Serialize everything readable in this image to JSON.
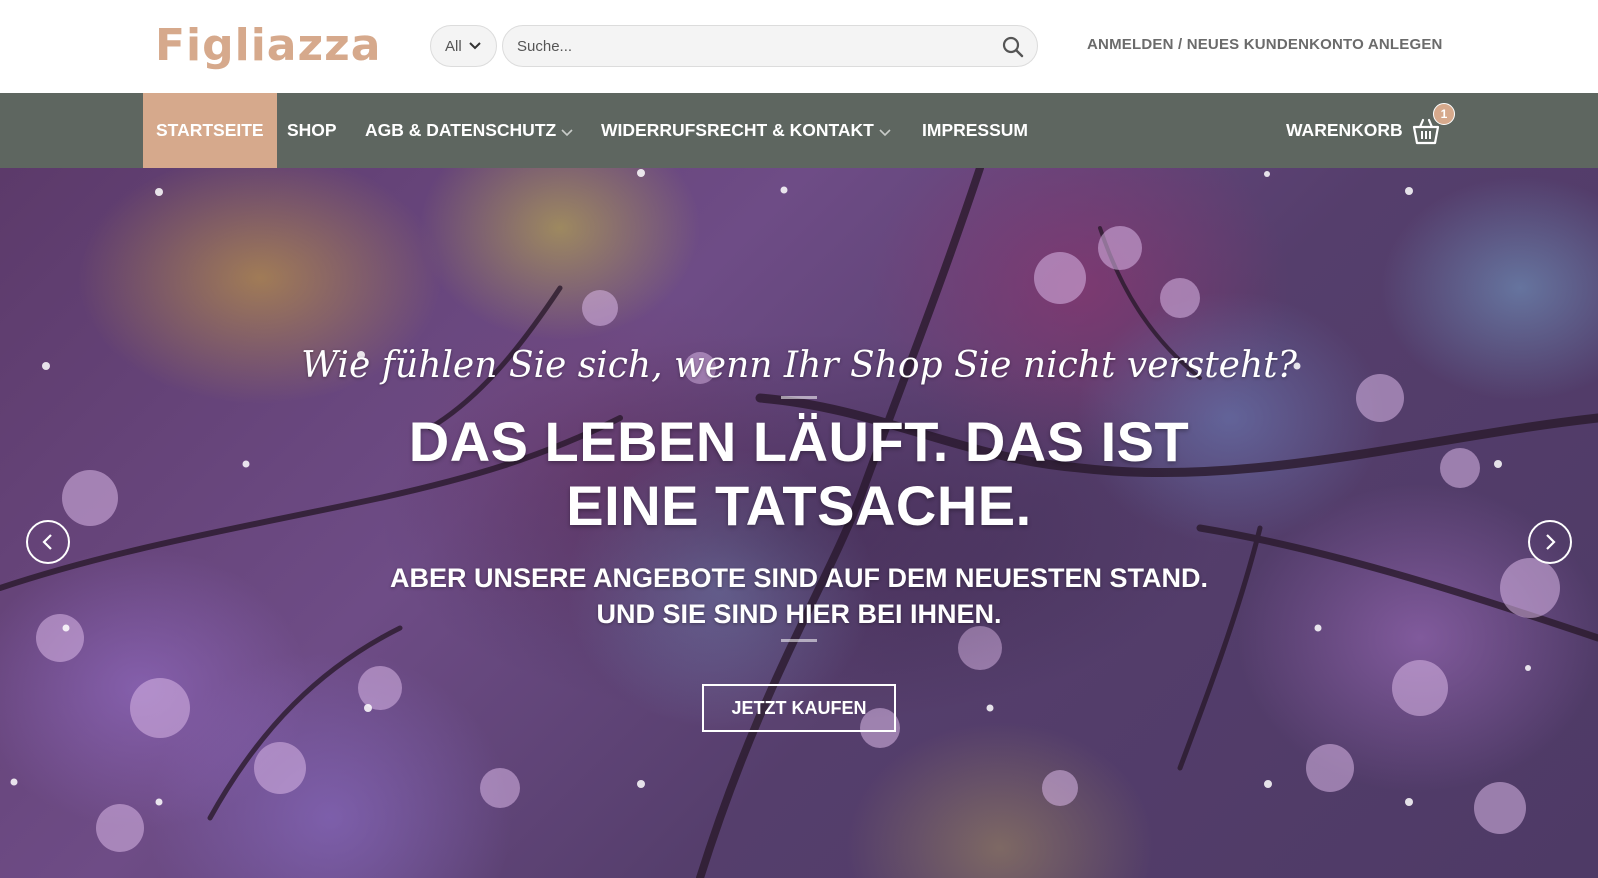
{
  "header": {
    "logo_text": "Figliazza",
    "category_select": "All",
    "search_placeholder": "Suche...",
    "account_link": "ANMELDEN / NEUES KUNDENKONTO ANLEGEN"
  },
  "nav": {
    "items": [
      {
        "label": "STARTSEITE",
        "active": true
      },
      {
        "label": "SHOP"
      },
      {
        "label": "AGB & DATENSCHUTZ",
        "dropdown": true
      },
      {
        "label": "WIDERRUFSRECHT & KONTAKT",
        "dropdown": true
      },
      {
        "label": "IMPRESSUM"
      }
    ],
    "cart_label": "WARENKORB",
    "cart_count": "1"
  },
  "hero": {
    "tagline": "Wie fühlen Sie sich, wenn Ihr Shop Sie nicht versteht?",
    "title_line1": "DAS LEBEN LÄUFT. DAS IST",
    "title_line2": "EINE TATSACHE.",
    "sub_line1": "ABER UNSERE ANGEBOTE SIND AUF DEM NEUESTEN STAND.",
    "sub_line2": "UND SIE SIND HIER BEI IHNEN.",
    "button_label": "JETZT KAUFEN"
  },
  "colors": {
    "accent": "#d6a98c",
    "nav_bg": "#5e6660",
    "text_muted": "#6b6b6b"
  },
  "icons": {
    "search": "search-icon",
    "cart": "basket-icon",
    "prev": "chevron-left-icon",
    "next": "chevron-right-icon",
    "dropdown": "chevron-down-icon"
  }
}
